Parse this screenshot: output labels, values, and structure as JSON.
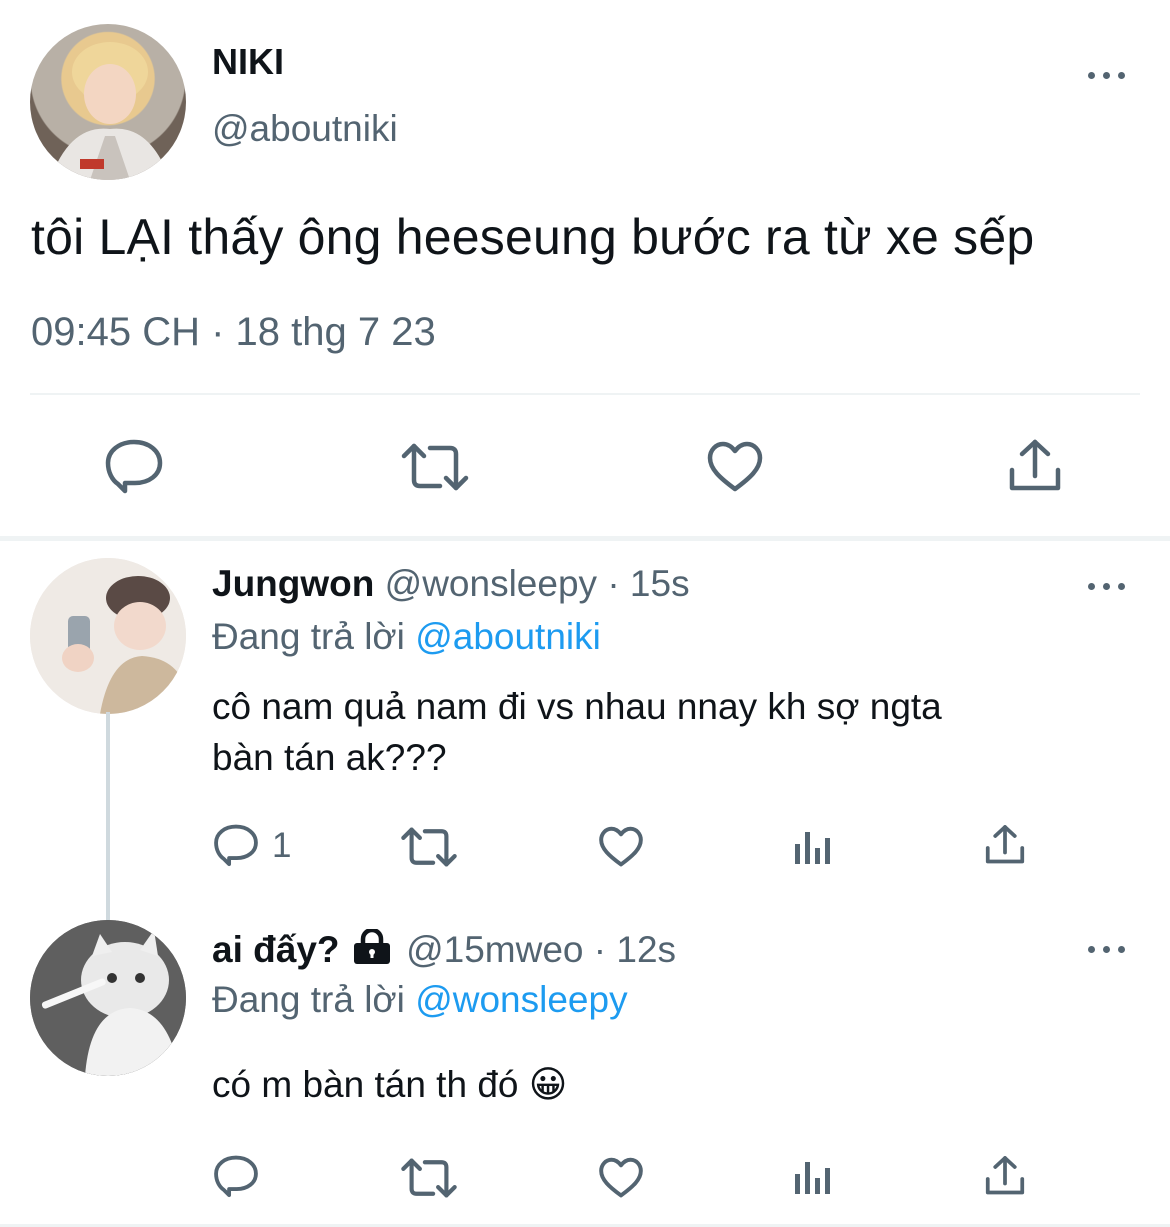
{
  "main_tweet": {
    "display_name": "NIKI",
    "handle": "@aboutniki",
    "text": "tôi LẠI thấy ông heeseung bước ra từ xe sếp",
    "timestamp": "09:45 CH · 18 thg 7 23"
  },
  "replies": [
    {
      "display_name": "Jungwon",
      "handle": "@wonsleepy",
      "time": "· 15s",
      "replying_prefix": "Đang trả lời",
      "replying_to": "@aboutniki",
      "text_line1": "cô nam quả nam đi vs nhau nnay kh sợ ngta",
      "text_line2": "bàn tán ak???",
      "reply_count": "1"
    },
    {
      "display_name": "ai đấy?",
      "locked": true,
      "handle": "@15mweo",
      "time": "· 12s",
      "replying_prefix": "Đang trả lời",
      "replying_to": "@wonsleepy",
      "text": "có m bàn tán th đó",
      "emoji": "😀"
    }
  ],
  "icons": {
    "reply": "reply-icon",
    "retweet": "retweet-icon",
    "like": "heart-icon",
    "views": "views-icon",
    "share": "share-icon",
    "more": "more-icon",
    "lock": "lock-icon"
  },
  "colors": {
    "text": "#0f1419",
    "secondary": "#536471",
    "link": "#1d9bf0",
    "divider": "#eff3f4"
  }
}
